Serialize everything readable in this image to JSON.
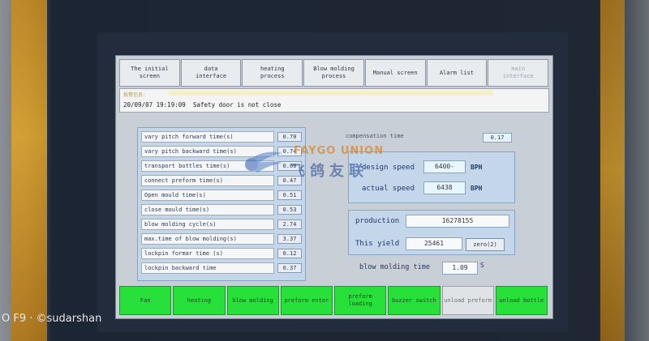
{
  "nav": {
    "tabs": [
      {
        "label": "The initial\nscreen"
      },
      {
        "label": "data\ninterface"
      },
      {
        "label": "heating\nprocess"
      },
      {
        "label": "Blow molding\nprocess"
      },
      {
        "label": "Manual screen"
      },
      {
        "label": "Alarm list"
      },
      {
        "label": "main\ninterface"
      }
    ]
  },
  "alarm": {
    "header": "报警信息:",
    "time": "20/09/07 19:19:09",
    "message": "Safety door is not close"
  },
  "params": [
    {
      "label": "vary pitch forward time(s)",
      "value": "0.70"
    },
    {
      "label": "vary pitch backward time(s)",
      "value": "0.74"
    },
    {
      "label": "transport bottles time(s)",
      "value": "0.60"
    },
    {
      "label": "connect preform time(s)",
      "value": "0.47"
    },
    {
      "label": "Open mould time(s)",
      "value": "0.51"
    },
    {
      "label": "close mould time(s)",
      "value": "0.53"
    },
    {
      "label": "blow molding cycle(s)",
      "value": "2.74"
    },
    {
      "label": "max.time of blow molding(s)",
      "value": "3.37"
    },
    {
      "label": "lockpin formar time (s)",
      "value": "0.12"
    },
    {
      "label": "lockpin backward time",
      "value": "0.37"
    }
  ],
  "compensation": {
    "label": "compensation time",
    "value": "0.17"
  },
  "speed": {
    "design_label": "design speed",
    "design_value": "6400-",
    "actual_label": "actual speed",
    "actual_value": "6438",
    "unit": "BPH"
  },
  "production": {
    "production_label": "production",
    "production_value": "16278155",
    "yield_label": "This yield",
    "yield_value": "25461",
    "zero_label": "zero(2)"
  },
  "blow_time": {
    "label": "blow molding time",
    "value": "1.09",
    "unit": "S"
  },
  "bottom_buttons": [
    {
      "label": "Fan"
    },
    {
      "label": "heating"
    },
    {
      "label": "blow molding"
    },
    {
      "label": "preform enter"
    },
    {
      "label": "preform\nloading"
    },
    {
      "label": "buzzer switch"
    },
    {
      "label": "unload preform"
    },
    {
      "label": "unload bottle"
    }
  ],
  "logo": {
    "en": "FAYGO UNION",
    "cn": "飞鸽友联"
  },
  "watermark": "O F9 · ©sudarshan",
  "colors": {
    "active_button": "#27e03a",
    "panel": "#c3d6ea",
    "accent": "#223a66"
  }
}
